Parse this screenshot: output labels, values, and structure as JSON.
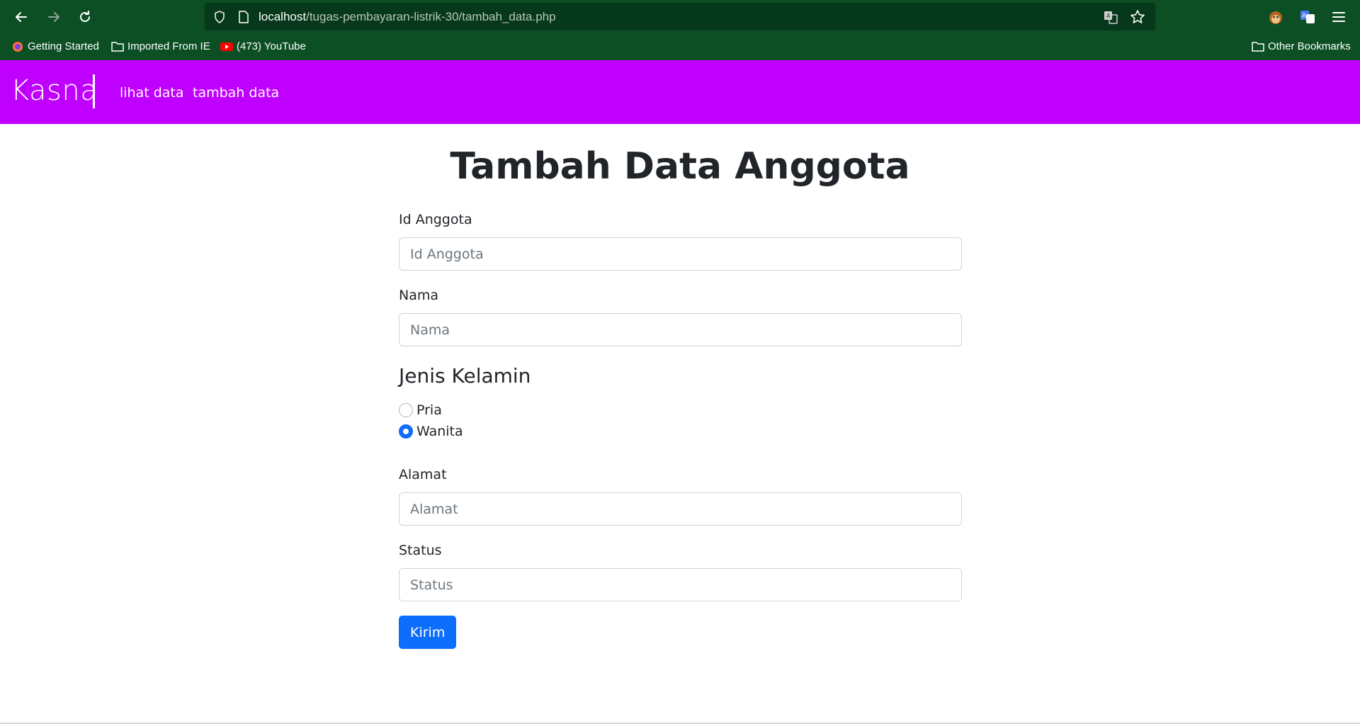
{
  "browser": {
    "url_host": "localhost",
    "url_path": "/tugas-pembayaran-listrik-30/tambah_data.php",
    "bookmarks": [
      {
        "label": "Getting Started",
        "icon": "firefox-icon"
      },
      {
        "label": "Imported From IE",
        "icon": "folder-icon"
      },
      {
        "label": "(473) YouTube",
        "icon": "youtube-icon"
      }
    ],
    "other_bookmarks": "Other Bookmarks"
  },
  "navbar": {
    "brand": "Kasna",
    "links": [
      "lihat data",
      "tambah data"
    ],
    "color": "#bf00ff"
  },
  "page": {
    "title": "Tambah Data Anggota"
  },
  "form": {
    "id_label": "Id Anggota",
    "id_placeholder": "Id Anggota",
    "nama_label": "Nama",
    "nama_placeholder": "Nama",
    "gender_heading": "Jenis Kelamin",
    "gender_options": [
      {
        "label": "Pria",
        "checked": false
      },
      {
        "label": "Wanita",
        "checked": true
      }
    ],
    "alamat_label": "Alamat",
    "alamat_placeholder": "Alamat",
    "status_label": "Status",
    "status_placeholder": "Status",
    "submit_label": "Kirim"
  }
}
